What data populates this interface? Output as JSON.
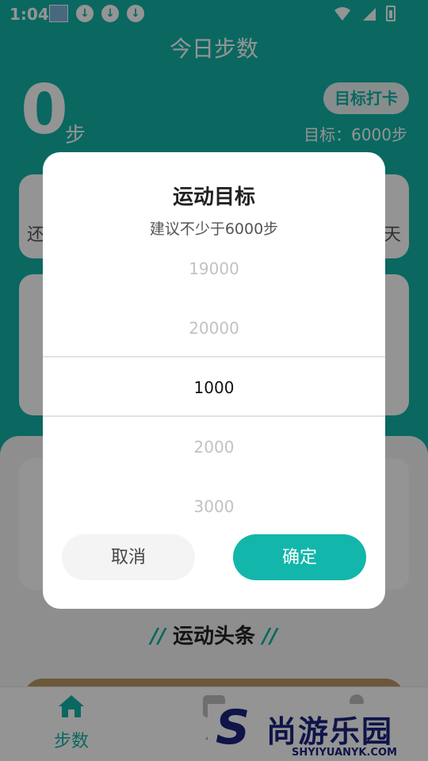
{
  "status_bar": {
    "time": "1:04",
    "download_icon_glyph": "↓",
    "notification_icons": [
      "image-icon",
      "download-icon",
      "download-icon",
      "download-icon"
    ],
    "system_icons": [
      "wifi-icon",
      "signal-icon",
      "battery-charging-icon"
    ]
  },
  "header": {
    "title": "今日步数",
    "steps": "0",
    "steps_unit": "步",
    "checkin_label": "目标打卡",
    "goal_text": "目标：6000步"
  },
  "card_1": {
    "left_text": "还",
    "right_text": "天"
  },
  "news": {
    "deco_left": "//",
    "title": "运动头条",
    "deco_right": "//"
  },
  "tabbar": {
    "items": [
      {
        "label": "步数",
        "icon": "home-icon",
        "active": true
      },
      {
        "label": "体",
        "icon": "body-icon",
        "active": false
      },
      {
        "label": "",
        "icon": "user-icon",
        "active": false
      }
    ]
  },
  "watermark": {
    "logo_letter": "S",
    "name": "尚游乐园",
    "url": "SHYIYUANYK.COM"
  },
  "dialog": {
    "title": "运动目标",
    "subtitle": "建议不少于6000步",
    "picker_options": [
      "19000",
      "20000",
      "1000",
      "2000",
      "3000"
    ],
    "selected_value": "1000",
    "cancel_label": "取消",
    "confirm_label": "确定"
  },
  "colors": {
    "accent": "#12b3a8",
    "confirm_button": "#13b6aa",
    "watermark": "#1a237e"
  }
}
